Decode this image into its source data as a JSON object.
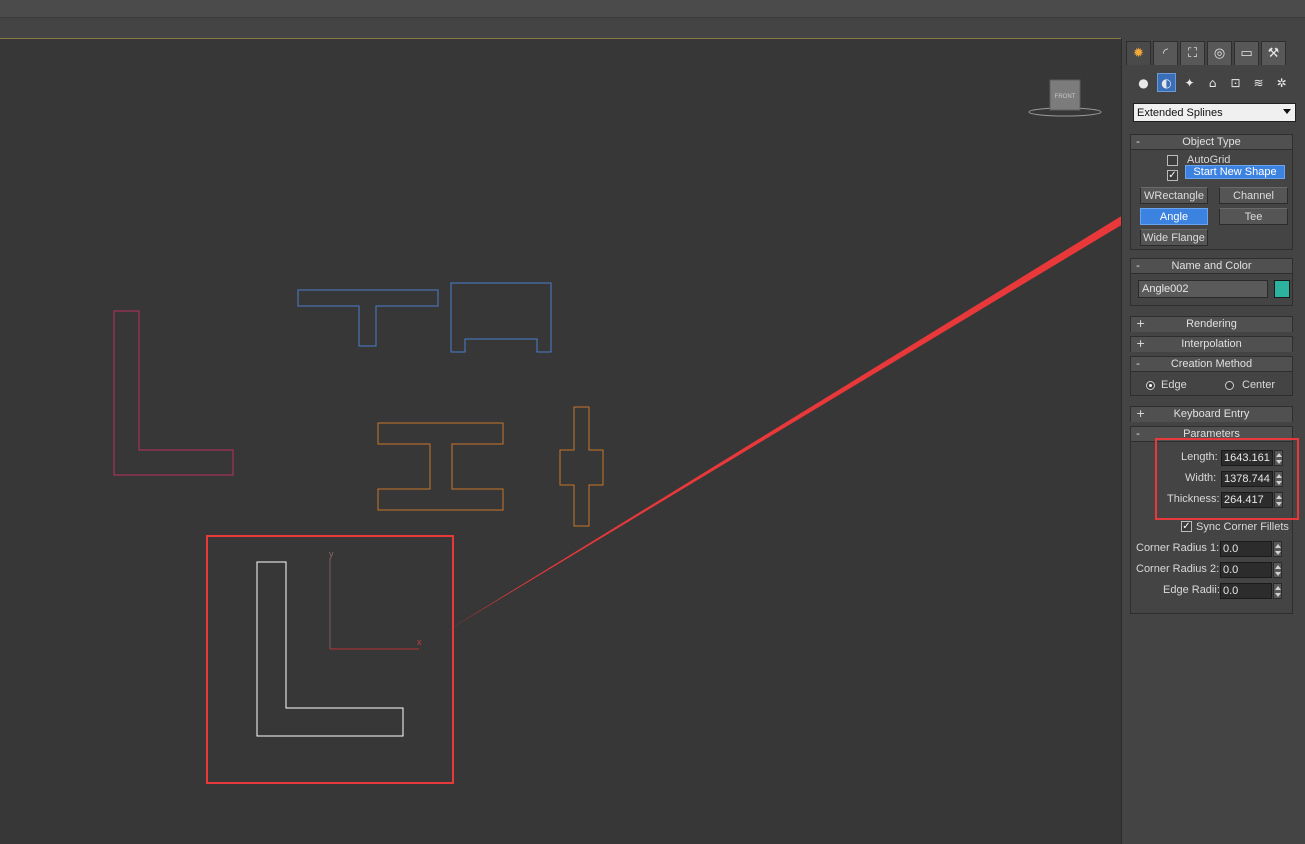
{
  "viewport": {
    "viewcube_label": "FRONT",
    "axis_y": "y",
    "axis_x": "x"
  },
  "command_panel": {
    "tabs": [
      {
        "name": "create",
        "glyph": "✹"
      },
      {
        "name": "modify",
        "glyph": "◜"
      },
      {
        "name": "hierarchy",
        "glyph": "⛶"
      },
      {
        "name": "motion",
        "glyph": "◎"
      },
      {
        "name": "display",
        "glyph": "▭"
      },
      {
        "name": "utilities",
        "glyph": "⚒"
      }
    ],
    "categories": [
      {
        "name": "geometry",
        "glyph": "●"
      },
      {
        "name": "shapes",
        "glyph": "◐"
      },
      {
        "name": "lights",
        "glyph": "✦"
      },
      {
        "name": "cameras",
        "glyph": "⌂"
      },
      {
        "name": "helpers",
        "glyph": "⊡"
      },
      {
        "name": "space-warps",
        "glyph": "≋"
      },
      {
        "name": "systems",
        "glyph": "✲"
      }
    ],
    "dropdown_value": "Extended Splines",
    "object_type": {
      "title": "Object Type",
      "sign": "-",
      "autogrid_label": "AutoGrid",
      "start_new_shape_label": "Start New Shape",
      "buttons": {
        "wrectangle": "WRectangle",
        "channel": "Channel",
        "angle": "Angle",
        "tee": "Tee",
        "wide_flange": "Wide Flange"
      }
    },
    "name_and_color": {
      "title": "Name and Color",
      "sign": "-",
      "name": "Angle002",
      "color": "#2bb3a0"
    },
    "rendering": {
      "title": "Rendering",
      "sign": "+"
    },
    "interpolation": {
      "title": "Interpolation",
      "sign": "+"
    },
    "creation_method": {
      "title": "Creation Method",
      "sign": "-",
      "edge_label": "Edge",
      "center_label": "Center",
      "selected": "Edge"
    },
    "keyboard_entry": {
      "title": "Keyboard Entry",
      "sign": "+"
    },
    "parameters": {
      "title": "Parameters",
      "sign": "-",
      "length_label": "Length:",
      "length_value": "1643.161",
      "width_label": "Width:",
      "width_value": "1378.744",
      "thickness_label": "Thickness:",
      "thickness_value": "264.417",
      "sync_label": "Sync Corner Fillets",
      "corner_radius_1_label": "Corner Radius 1:",
      "corner_radius_1_value": "0.0",
      "corner_radius_2_label": "Corner Radius 2:",
      "corner_radius_2_value": "0.0",
      "edge_radii_label": "Edge Radii:",
      "edge_radii_value": "0.0"
    }
  },
  "colors": {
    "annotation_red": "#e8383a",
    "highlight_blue": "#3c82e0",
    "shape_crimson": "#b8325a",
    "shape_blue": "#4a7ccc",
    "shape_orange": "#c8742a",
    "shape_selected": "#ffffff"
  }
}
